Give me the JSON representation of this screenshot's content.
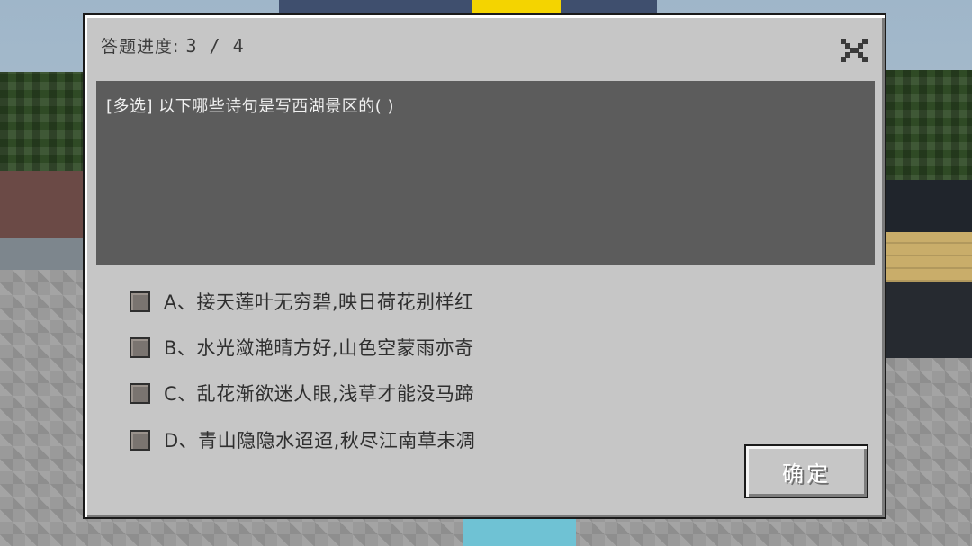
{
  "dialog": {
    "progress_label": "答题进度:",
    "progress_value": "3 / 4",
    "close_icon": "close-x-icon",
    "question": "[多选] 以下哪些诗句是写西湖景区的(  )",
    "options": [
      {
        "label": "A、接天莲叶无穷碧,映日荷花别样红",
        "checked": false
      },
      {
        "label": "B、水光潋滟晴方好,山色空蒙雨亦奇",
        "checked": false
      },
      {
        "label": "C、乱花渐欲迷人眼,浅草才能没马蹄",
        "checked": false
      },
      {
        "label": "D、青山隐隐水迢迢,秋尽江南草未凋",
        "checked": false
      }
    ],
    "confirm_label": "确定"
  },
  "colors": {
    "panel": "#c6c6c6",
    "question_bg": "#5c5c5c",
    "checkbox": "#7a7470"
  }
}
